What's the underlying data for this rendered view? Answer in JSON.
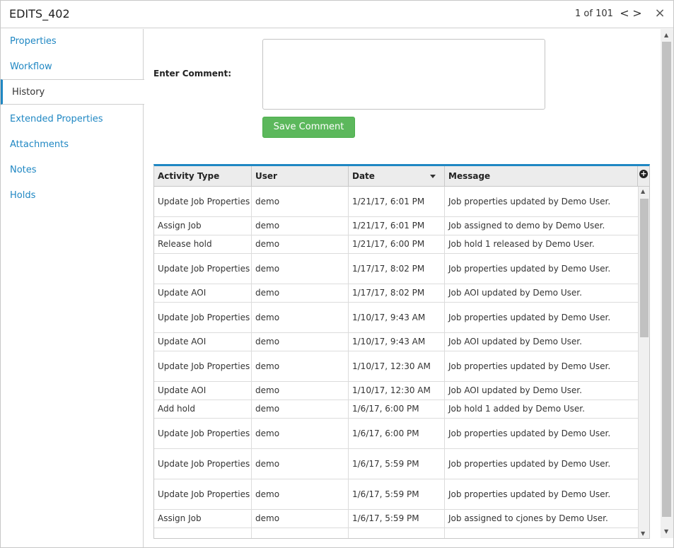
{
  "window": {
    "title": "EDITS_402",
    "pager": "1 of 101",
    "prev_label": "<",
    "next_label": ">",
    "close_label": "×"
  },
  "sidebar": {
    "items": [
      {
        "label": "Properties"
      },
      {
        "label": "Workflow"
      },
      {
        "label": "History"
      },
      {
        "label": "Extended Properties"
      },
      {
        "label": "Attachments"
      },
      {
        "label": "Notes"
      },
      {
        "label": "Holds"
      }
    ],
    "active": "History"
  },
  "comment": {
    "label": "Enter Comment:",
    "value": "",
    "placeholder": "",
    "save_label": "Save Comment"
  },
  "history": {
    "columns": [
      "Activity Type",
      "User",
      "Date",
      "Message"
    ],
    "sorted_column": "Date",
    "column_toggle_icon": "+",
    "rows": [
      {
        "activity": "Update Job Properties",
        "user": "demo",
        "date": "1/21/17, 6:01 PM",
        "message": "Job properties updated by Demo User."
      },
      {
        "activity": "Assign Job",
        "user": "demo",
        "date": "1/21/17, 6:01 PM",
        "message": "Job assigned to demo by Demo User."
      },
      {
        "activity": "Release hold",
        "user": "demo",
        "date": "1/21/17, 6:00 PM",
        "message": "Job hold 1 released by Demo User."
      },
      {
        "activity": "Update Job Properties",
        "user": "demo",
        "date": "1/17/17, 8:02 PM",
        "message": "Job properties updated by Demo User."
      },
      {
        "activity": "Update AOI",
        "user": "demo",
        "date": "1/17/17, 8:02 PM",
        "message": "Job AOI updated by Demo User."
      },
      {
        "activity": "Update Job Properties",
        "user": "demo",
        "date": "1/10/17, 9:43 AM",
        "message": "Job properties updated by Demo User."
      },
      {
        "activity": "Update AOI",
        "user": "demo",
        "date": "1/10/17, 9:43 AM",
        "message": "Job AOI updated by Demo User."
      },
      {
        "activity": "Update Job Properties",
        "user": "demo",
        "date": "1/10/17, 12:30 AM",
        "message": "Job properties updated by Demo User."
      },
      {
        "activity": "Update AOI",
        "user": "demo",
        "date": "1/10/17, 12:30 AM",
        "message": "Job AOI updated by Demo User."
      },
      {
        "activity": "Add hold",
        "user": "demo",
        "date": "1/6/17, 6:00 PM",
        "message": "Job hold 1 added by Demo User."
      },
      {
        "activity": "Update Job Properties",
        "user": "demo",
        "date": "1/6/17, 6:00 PM",
        "message": "Job properties updated by Demo User."
      },
      {
        "activity": "Update Job Properties",
        "user": "demo",
        "date": "1/6/17, 5:59 PM",
        "message": "Job properties updated by Demo User."
      },
      {
        "activity": "Update Job Properties",
        "user": "demo",
        "date": "1/6/17, 5:59 PM",
        "message": "Job properties updated by Demo User."
      },
      {
        "activity": "Assign Job",
        "user": "demo",
        "date": "1/6/17, 5:59 PM",
        "message": "Job assigned to cjones by Demo User."
      },
      {
        "activity": "Update Job Properties",
        "user": "",
        "date": "",
        "message": ""
      }
    ]
  },
  "colors": {
    "accent": "#1f87c3",
    "save_button": "#5cb85c"
  }
}
